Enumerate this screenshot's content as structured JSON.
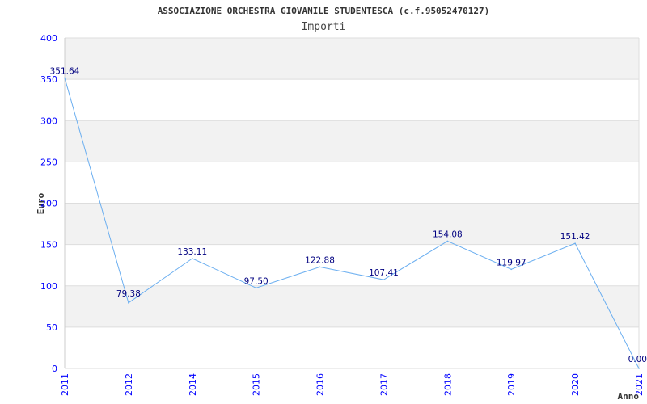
{
  "chart_data": {
    "type": "line",
    "title": "ASSOCIAZIONE ORCHESTRA GIOVANILE STUDENTESCA (c.f.95052470127)",
    "subtitle": "Importi",
    "xlabel": "Anno",
    "ylabel": "Euro",
    "categories": [
      "2011",
      "2012",
      "2014",
      "2015",
      "2016",
      "2017",
      "2018",
      "2019",
      "2020",
      "2021"
    ],
    "values": [
      351.64,
      79.38,
      133.11,
      97.5,
      122.88,
      107.41,
      154.08,
      119.97,
      151.42,
      0.0
    ],
    "data_labels": [
      "351.64",
      "79.38",
      "133.11",
      "97.50",
      "122.88",
      "107.41",
      "154.08",
      "119.97",
      "151.42",
      "0.00"
    ],
    "ylim": [
      0,
      400
    ],
    "yticks": [
      0,
      50,
      100,
      150,
      200,
      250,
      300,
      350,
      400
    ],
    "grid": true,
    "colors": {
      "line": "#6aaef0",
      "tick_labels": "#0000ff",
      "data_labels": "#000080",
      "band": "#f2f2f2",
      "title": "#333333"
    }
  }
}
